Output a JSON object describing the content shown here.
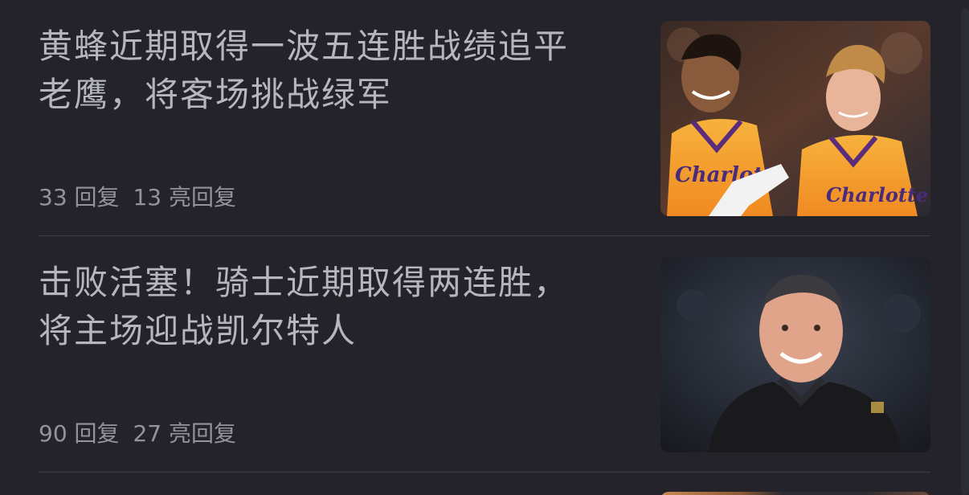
{
  "feed": {
    "items": [
      {
        "title_line1": "黄蜂近期取得一波五连胜战绩追平",
        "title_line2": "老鹰，将客场挑战绿军",
        "replies": "33 回复",
        "highlight_replies": "13 亮回复",
        "thumbnail_desc": "两名黄蜂球员身穿Charlotte橙色球衣微笑",
        "jersey_text": "Charlotte"
      },
      {
        "title_line1": "击败活塞！骑士近期取得两连胜，",
        "title_line2": "将主场迎战凯尔特人",
        "replies": "90 回复",
        "highlight_replies": "27 亮回复",
        "thumbnail_desc": "身穿黑色外套的教练微笑"
      }
    ]
  },
  "colors": {
    "background": "#232329",
    "title_text": "#b6b6c0",
    "meta_text": "#93939d",
    "divider": "#3c3c45"
  }
}
